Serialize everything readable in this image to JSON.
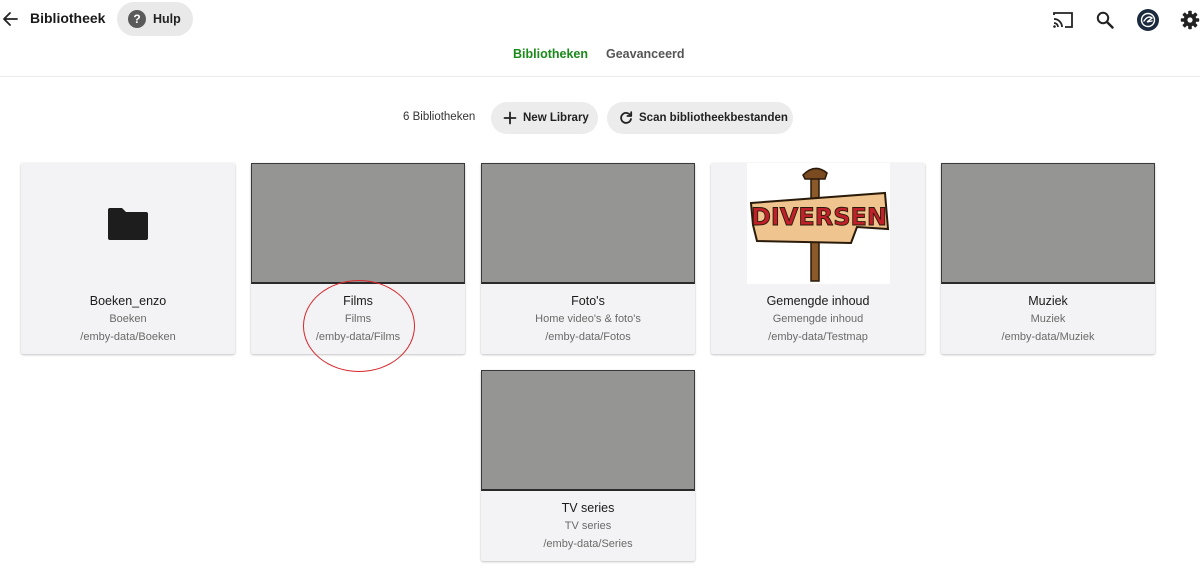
{
  "header": {
    "title": "Bibliotheek",
    "help_label": "Hulp",
    "help_glyph": "?",
    "icons": [
      "back-arrow-icon",
      "cast-icon",
      "search-icon",
      "user-avatar",
      "settings-icon"
    ]
  },
  "tabs": [
    {
      "label": "Bibliotheken",
      "active": true
    },
    {
      "label": "Geavanceerd",
      "active": false
    }
  ],
  "toolbar": {
    "count_label": "6 Bibliotheken",
    "new_library_label": "New Library",
    "scan_label": "Scan bibliotheekbestanden"
  },
  "libraries": [
    {
      "name": "Boeken_enzo",
      "type": "Boeken",
      "path": "/emby-data/Boeken",
      "image": "folder-icon"
    },
    {
      "name": "Films",
      "type": "Films",
      "path": "/emby-data/Films",
      "image": "gray-thumbnail"
    },
    {
      "name": "Foto's",
      "type": "Home video's & foto's",
      "path": "/emby-data/Fotos",
      "image": "gray-thumbnail"
    },
    {
      "name": "Gemengde inhoud",
      "type": "Gemengde inhoud",
      "path": "/emby-data/Testmap",
      "image": "diversen-sign",
      "image_text": "DIVERSEN"
    },
    {
      "name": "Muziek",
      "type": "Muziek",
      "path": "/emby-data/Muziek",
      "image": "gray-thumbnail"
    },
    {
      "name": "TV series",
      "type": "TV series",
      "path": "/emby-data/Series",
      "image": "gray-thumbnail"
    }
  ],
  "colors": {
    "accent": "#1a8a1a",
    "highlight_circle": "#d8262b",
    "thumbnail_gray": "#959694"
  }
}
